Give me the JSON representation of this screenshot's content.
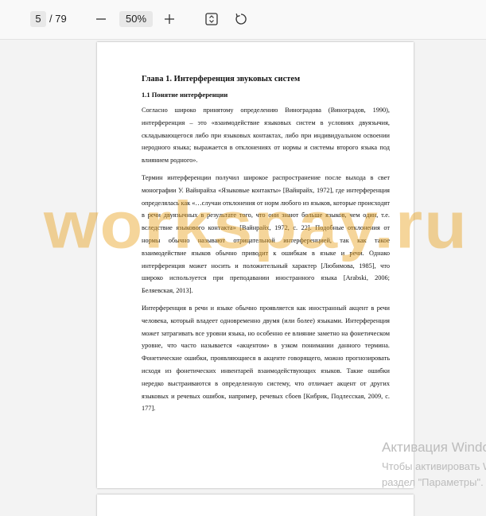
{
  "toolbar": {
    "page_current": "5",
    "page_total": "/ 79",
    "zoom": "50%"
  },
  "icons": {
    "zoom_out": "minus-icon",
    "zoom_in": "plus-icon",
    "fit": "fit-page-icon",
    "rotate": "rotate-icon"
  },
  "document": {
    "chapter_title": "Глава 1. Интерференция звуковых систем",
    "section_title": "1.1 Понятие интерференции",
    "paragraphs": [
      "Согласно широко принятому определению Виноградова (Виноградов, 1990), интерференция – это «взаимодействие языковых систем в условиях двуязычия, складывающегося либо при языковых контактах, либо при индивидуальном освоении неродного языка; выражается в отклонениях от нормы и системы второго языка под влиянием родного».",
      "Термин интерференции получил широкое распространение после выхода в свет монографии У. Вайнрайха «Языковые контакты» [Вайнрайх, 1972], где интерференция определялась как «…случаи отклонения от норм любого из языков, которые происходят в речи двуязычных в результате того, что они знают больше языков, чем один, т.е. вследствие языкового контакта» [Вайнрайх, 1972, с. 22]. Подобные отклонения от нормы обычно называют отрицательной интерференцией, так как такое взаимодействие языков обычно приводит к ошибкам в языке и речи. Однако интерференция может носить и положительный характер [Любимова, 1985], что широко используется при преподавании иностранного языка [Arabski, 2006; Беляевская, 2013].",
      "Интерференция в речи и языке обычно проявляется как иностранный акцент в речи человека, который владеет одновременно двумя (или более) языками. Интерференция может затрагивать все уровни языка, но особенно ее влияние заметно на фонетическом уровне, что часто называется «акцентом» в узком понимании данного термина. Фонетические ошибки, проявляющиеся в акценте говорящего, можно прогнозировать исходя из фонетических инвентарей взаимодействующих языков. Такие ошибки нередко выстраиваются в определенную систему, что отличает акцент от других языковых и речевых ошибок, например, речевых сбоев [Кибрик, Подлесская, 2009, с. 177]."
    ]
  },
  "watermark": "workspay.ru",
  "activation": {
    "title": "Активация Windows",
    "line1": "Чтобы активировать Windows, перейдите в",
    "line2": "раздел \"Параметры\"."
  }
}
